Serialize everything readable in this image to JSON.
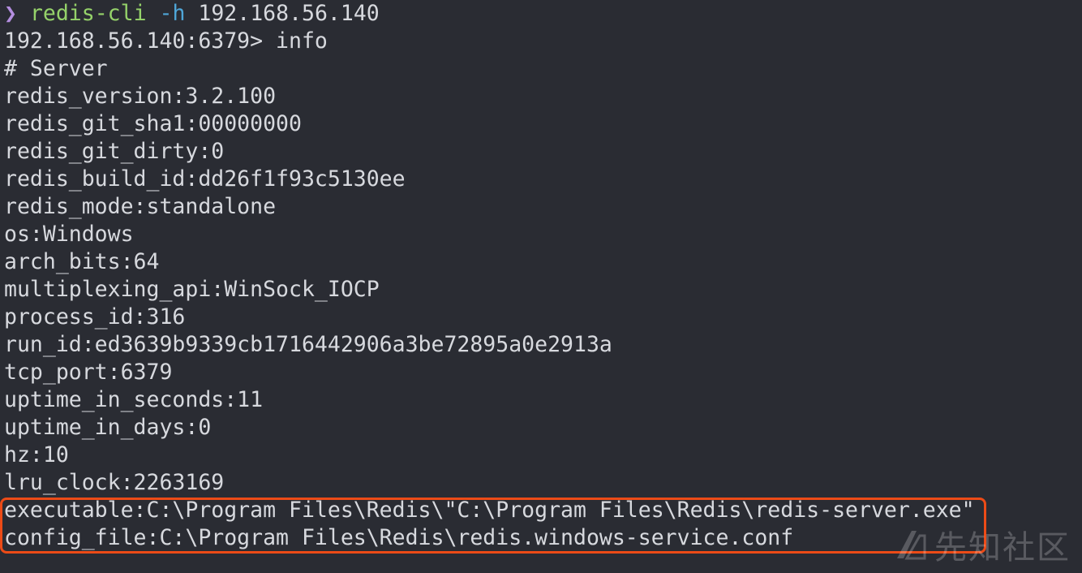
{
  "terminal": {
    "prompt_symbol": "❯",
    "command_name": "redis-cli",
    "command_flag": "-h",
    "command_arg": "192.168.56.140",
    "lines": [
      "192.168.56.140:6379> info",
      "# Server",
      "redis_version:3.2.100",
      "redis_git_sha1:00000000",
      "redis_git_dirty:0",
      "redis_build_id:dd26f1f93c5130ee",
      "redis_mode:standalone",
      "os:Windows",
      "arch_bits:64",
      "multiplexing_api:WinSock_IOCP",
      "process_id:316",
      "run_id:ed3639b9339cb1716442906a3be72895a0e2913a",
      "tcp_port:6379",
      "uptime_in_seconds:11",
      "uptime_in_days:0",
      "hz:10",
      "lru_clock:2263169"
    ],
    "highlighted_lines": [
      "executable:C:\\Program Files\\Redis\\\"C:\\Program Files\\Redis\\redis-server.exe\"",
      "config_file:C:\\Program Files\\Redis\\redis.windows-service.conf"
    ]
  },
  "watermark": {
    "text": "先知社区",
    "icon": "xianzhi-logo-icon"
  },
  "colors": {
    "background": "#2a2c33",
    "text": "#d7d9de",
    "prompt": "#b48ee0",
    "command": "#95d26a",
    "flag": "#4fa6d8",
    "highlight_border": "#ec4b17"
  }
}
